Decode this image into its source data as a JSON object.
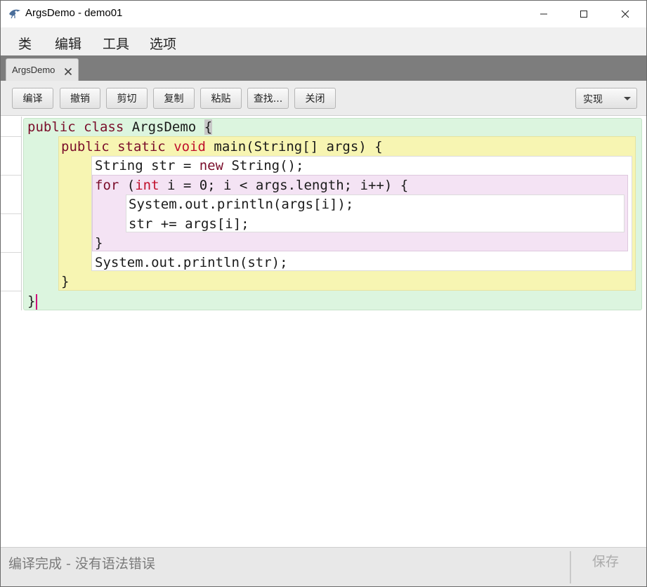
{
  "window": {
    "title": "ArgsDemo - demo01",
    "icon": "bird-eye-icon"
  },
  "menu": {
    "items": [
      "类",
      "编辑",
      "工具",
      "选项"
    ]
  },
  "tabs": [
    {
      "label": "ArgsDemo",
      "active": true
    }
  ],
  "toolbar": {
    "buttons": [
      "编译",
      "撤销",
      "剪切",
      "复制",
      "粘贴",
      "查找...",
      "关闭"
    ],
    "view_select": "实现"
  },
  "editor": {
    "lines": [
      "public class ArgsDemo {",
      "public static void main(String[] args) {",
      "String str = new String();",
      "for (int i = 0; i < args.length; i++) {",
      "System.out.println(args[i]);",
      "str += args[i];",
      "}",
      "System.out.println(str);",
      "}",
      "}"
    ]
  },
  "status": {
    "message": "编译完成 - 没有语法错误",
    "save_label": "保存"
  },
  "colors": {
    "class_scope": "#dcf5df",
    "method_scope": "#f7f5b2",
    "loop_scope": "#f4e3f4",
    "keyword": "#7a0d2a",
    "keyword_type": "#c0102c"
  }
}
